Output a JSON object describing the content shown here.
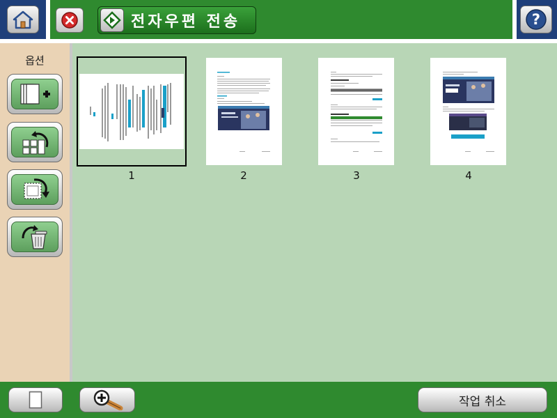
{
  "header": {
    "title": "전자우편 전송",
    "home_icon": "home-icon",
    "cancel_icon": "cancel-x-icon",
    "send_icon": "start-send-icon",
    "help_icon": "help-question-icon"
  },
  "sidebar": {
    "title": "옵션",
    "buttons": [
      {
        "name": "add-page-button",
        "icon": "add-page-icon"
      },
      {
        "name": "rotate-page-button",
        "icon": "rotate-grid-icon"
      },
      {
        "name": "rotate-image-button",
        "icon": "rotate-image-icon"
      },
      {
        "name": "delete-page-button",
        "icon": "recycle-bin-icon"
      }
    ]
  },
  "pages": [
    {
      "label": "1",
      "selected": true
    },
    {
      "label": "2",
      "selected": false
    },
    {
      "label": "3",
      "selected": false
    },
    {
      "label": "4",
      "selected": false
    }
  ],
  "footer": {
    "cancel_job_label": "작업 취소",
    "page_view_icon": "single-page-icon",
    "zoom_icon": "magnifier-zoom-icon"
  },
  "colors": {
    "top_green": "#2f8a2f",
    "top_blue": "#1f3f7a",
    "main_bg": "#b8d6b6",
    "sidebar_bg": "#ead3b5",
    "button_green": "#5d9f5d"
  }
}
